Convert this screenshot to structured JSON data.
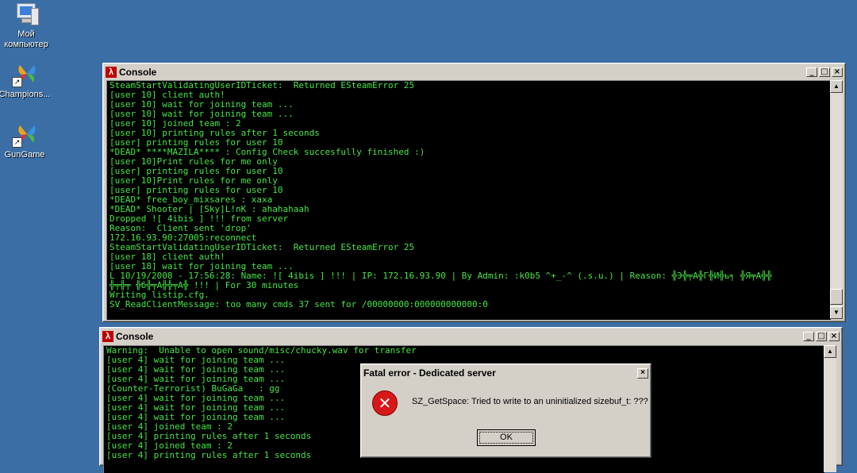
{
  "desktop": {
    "icons": [
      {
        "label_line1": "Мой",
        "label_line2": "компьютер",
        "icon": "my-computer-icon"
      },
      {
        "label_line1": "Champions...",
        "label_line2": "",
        "icon": "butterfly-shortcut-icon"
      },
      {
        "label_line1": "GunGame",
        "label_line2": "",
        "icon": "butterfly-shortcut-icon"
      }
    ],
    "background_color": "#3a6ea5"
  },
  "console1": {
    "title": "Console",
    "text": "SteamStartValidatingUserIDTicket:  Returned ESteamError 25\n[user 10] client auth!\n[user 10] wait for joining team ...\n[user 10] wait for joining team ...\n[user 10] joined team : 2\n[user 10] printing rules after 1 seconds\n[user] printing rules for user 10\n*DEAD* ****MAZILA**** : Config Check succesfully finished :)\n[user 10]Print rules for me only\n[user] printing rules for user 10\n[user 10]Print rules for me only\n[user] printing rules for user 10\n*DEAD* free_boy_mixsares : xaxa\n*DEAD* Shooter | [Sky]L!nK : ahahahaah\nDropped ![ 4ibis ] !!! from server\nReason:  Client sent 'drop'\n172.16.93.90:27005:reconnect\nSteamStartValidatingUserIDTicket:  Returned ESteamError 25\n[user 18] client auth!\n[user 18] wait for joining team ...\nL 10/19/2008 - 17:56:28: Name: ![ 4ibis ] !!! | IP: 172.16.93.90 | By Admin: :k0b5 ^+_-^ (.s.u.) | Reason: ╬Э╬╤А╬Г╬И╬ь╕ ╬Я╤А╬╬\n╬╤╬╤ ╬б╬╤А╬╬╤А╬ !!! | For 30 minutes\nWriting listip.cfg.\nSV_ReadClientMessage: too many cmds 37 sent for /00000000:000000000000:0"
  },
  "console2": {
    "title": "Console",
    "text": "Warning:  Unable to open sound/misc/chucky.wav for transfer\n[user 4] wait for joining team ...\n[user 4] wait for joining team ...\n[user 4] wait for joining team ...\n(Counter-Terrorist) BuGaGa   : gg\n[user 4] wait for joining team ...\n[user 4] wait for joining team ...\n[user 4] wait for joining team ...\n[user 4] joined team : 2\n[user 4] printing rules after 1 seconds\n[user 4] joined team : 2\n[user 4] printing rules after 1 seconds"
  },
  "dialog": {
    "title": "Fatal error - Dedicated server",
    "message": "SZ_GetSpace:  Tried to write to an uninitialized sizebuf_t: ???",
    "ok_label": "OK",
    "close_label": "×",
    "icon": "error-icon"
  },
  "window_buttons": {
    "minimize": "_",
    "maximize": "□",
    "close": "×"
  },
  "colors": {
    "console_text": "#46e646",
    "console_bg": "#000000",
    "title_icon": "#c00000"
  }
}
